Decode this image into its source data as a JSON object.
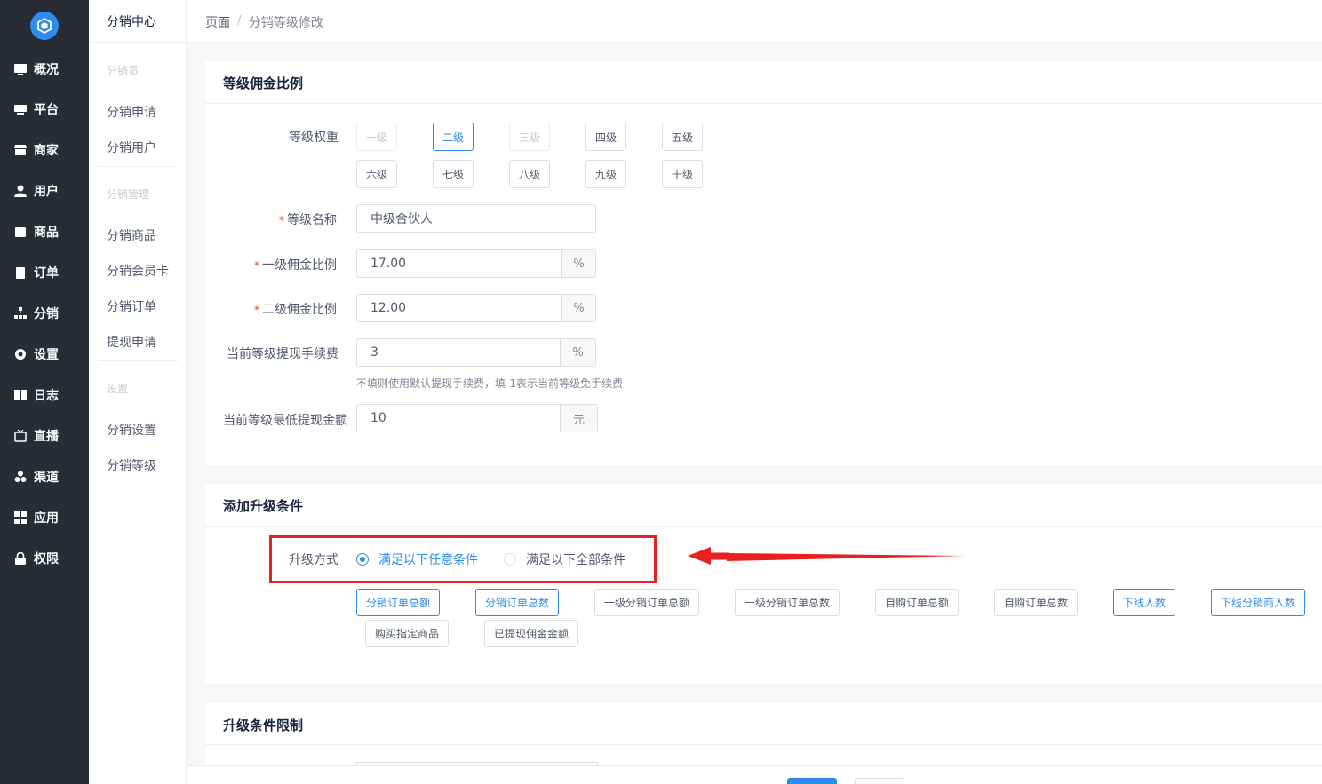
{
  "sidebar": {
    "items": [
      {
        "label": "概况",
        "icon": "monitor-chart-icon"
      },
      {
        "label": "平台",
        "icon": "desktop-icon"
      },
      {
        "label": "商家",
        "icon": "store-icon"
      },
      {
        "label": "用户",
        "icon": "user-icon"
      },
      {
        "label": "商品",
        "icon": "bag-icon"
      },
      {
        "label": "订单",
        "icon": "clipboard-icon"
      },
      {
        "label": "分销",
        "icon": "sitemap-icon"
      },
      {
        "label": "设置",
        "icon": "gear-icon"
      },
      {
        "label": "日志",
        "icon": "book-icon"
      },
      {
        "label": "直播",
        "icon": "tv-icon"
      },
      {
        "label": "渠道",
        "icon": "cubes-icon"
      },
      {
        "label": "应用",
        "icon": "grid-icon"
      },
      {
        "label": "权限",
        "icon": "lock-icon"
      }
    ]
  },
  "submenu": {
    "title": "分销中心",
    "groups": [
      {
        "name": "分销员",
        "items": [
          "分销申请",
          "分销用户"
        ]
      },
      {
        "name": "分销管理",
        "items": [
          "分销商品",
          "分销会员卡",
          "分销订单",
          "提现申请"
        ]
      },
      {
        "name": "设置",
        "items": [
          "分销设置",
          "分销等级"
        ]
      }
    ]
  },
  "breadcrumb": {
    "root": "页面",
    "separator": "/",
    "current": "分销等级修改"
  },
  "commission": {
    "title": "等级佣金比例",
    "weight_label": "等级权重",
    "levels": [
      "一级",
      "二级",
      "三级",
      "四级",
      "五级",
      "六级",
      "七级",
      "八级",
      "九级",
      "十级"
    ],
    "name_label": "等级名称",
    "name_value": "中级合伙人",
    "first_label": "一级佣金比例",
    "first_value": "17.00",
    "second_label": "二级佣金比例",
    "second_value": "12.00",
    "percent": "%",
    "fee_label": "当前等级提现手续费",
    "fee_value": "3",
    "fee_hint": "不填则使用默认提现手续费，填-1表示当前等级免手续费",
    "min_label": "当前等级最低提现金额",
    "min_value": "10",
    "yuan": "元"
  },
  "upgrade": {
    "title": "添加升级条件",
    "mode_label": "升级方式",
    "option_any": "满足以下任意条件",
    "option_all": "满足以下全部条件",
    "conditions": [
      "分销订单总额",
      "分销订单总数",
      "一级分销订单总额",
      "一级分销订单总数",
      "自购订单总额",
      "自购订单总数",
      "下线人数",
      "下线分销商人数",
      "购买指定商品",
      "已提现佣金金额"
    ]
  },
  "limit": {
    "title": "升级条件限制"
  },
  "colors": {
    "primary": "#2d8cf0",
    "sidebar": "#282c34",
    "highlight": "#ea1f1f"
  }
}
